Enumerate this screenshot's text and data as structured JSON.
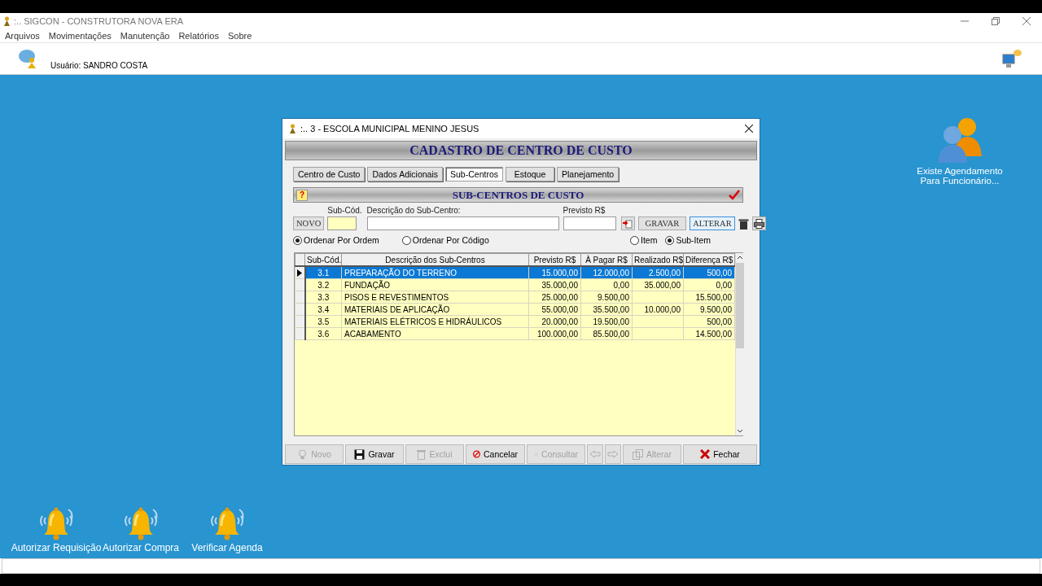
{
  "window": {
    "title": ":.. SIGCON - CONSTRUTORA NOVA ERA"
  },
  "menu": [
    "Arquivos",
    "Movimentações",
    "Manutenção",
    "Relatórios",
    "Sobre"
  ],
  "user": {
    "label": "Usuário: SANDRO COSTA"
  },
  "notice": {
    "label": "Existe Agendamento Para Funcionário..."
  },
  "shortcuts": [
    {
      "label": "Autorizar Requisição"
    },
    {
      "label": "Autorizar Compra"
    },
    {
      "label": "Verificar Agenda"
    }
  ],
  "dialog": {
    "title": ":.. 3 - ESCOLA MUNICIPAL MENINO JESUS",
    "heading": "CADASTRO DE CENTRO DE CUSTO",
    "tabs": [
      {
        "label": "Centro de Custo",
        "selected": false
      },
      {
        "label": "Dados Adicionais",
        "selected": false
      },
      {
        "label": "Sub-Centros",
        "selected": true
      },
      {
        "label": "Estoque",
        "selected": false
      },
      {
        "label": "Planejamento",
        "selected": false
      }
    ],
    "section_title": "SUB-CENTROS DE CUSTO",
    "help": "?",
    "form": {
      "new_button": "NOVO",
      "code_label": "Sub-Cód.",
      "description_label": "Descrição do Sub-Centro:",
      "planned_label": "Previsto R$",
      "save_button": "GRAVAR",
      "edit_button": "ALTERAR"
    },
    "order_options": [
      {
        "label": "Ordenar Por Ordem",
        "selected": true
      },
      {
        "label": "Ordenar Por Código",
        "selected": false
      }
    ],
    "level_options": [
      {
        "label": "Item",
        "selected": false
      },
      {
        "label": "Sub-Item",
        "selected": true
      }
    ],
    "table": {
      "columns": [
        "Sub-Cód.",
        "Descrição dos Sub-Centros",
        "Previsto R$",
        "À Pagar R$",
        "Realizado R$",
        "Diferença R$"
      ],
      "rows": [
        {
          "cells": [
            "3.1",
            "PREPARAÇÃO DO TERRENO",
            "15.000,00",
            "12.000,00",
            "2.500,00",
            "500,00"
          ],
          "selected": true
        },
        {
          "cells": [
            "3.2",
            "FUNDAÇÃO",
            "35.000,00",
            "0,00",
            "35.000,00",
            "0,00"
          ],
          "selected": false
        },
        {
          "cells": [
            "3.3",
            "PISOS E REVESTIMENTOS",
            "25.000,00",
            "9.500,00",
            "",
            "15.500,00"
          ],
          "selected": false
        },
        {
          "cells": [
            "3.4",
            "MATERIAIS DE APLICAÇÃO",
            "55.000,00",
            "35.500,00",
            "10.000,00",
            "9.500,00"
          ],
          "selected": false
        },
        {
          "cells": [
            "3.5",
            "MATERIAIS ELÉTRICOS E HIDRÁULICOS",
            "20.000,00",
            "19.500,00",
            "",
            "500,00"
          ],
          "selected": false
        },
        {
          "cells": [
            "3.6",
            "ACABAMENTO",
            "100.000,00",
            "85.500,00",
            "",
            "14.500,00"
          ],
          "selected": false
        }
      ]
    },
    "buttons": [
      {
        "kind": "new",
        "label": "Novo",
        "disabled": true
      },
      {
        "kind": "save",
        "label": "Gravar",
        "disabled": false
      },
      {
        "kind": "delete",
        "label": "Exclui",
        "disabled": true
      },
      {
        "kind": "cancel",
        "label": "Cancelar",
        "disabled": false
      },
      {
        "kind": "search",
        "label": "Consultar",
        "disabled": true
      },
      {
        "kind": "prev",
        "disabled": true
      },
      {
        "kind": "next",
        "disabled": true
      },
      {
        "kind": "edit",
        "label": "Alterar",
        "disabled": true
      },
      {
        "kind": "close",
        "label": "Fechar",
        "disabled": false
      }
    ]
  }
}
